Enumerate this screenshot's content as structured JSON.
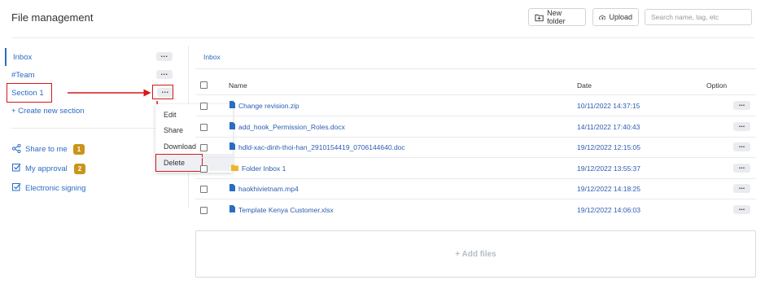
{
  "header": {
    "title": "File management",
    "new_folder_label": "New folder",
    "upload_label": "Upload",
    "search_placeholder": "Search name, tag, etc"
  },
  "sidebar": {
    "sections": [
      {
        "label": "Inbox"
      },
      {
        "label": "#Team"
      },
      {
        "label": "Section 1"
      }
    ],
    "create_section_label": "+ Create new section",
    "links": [
      {
        "label": "Share to me",
        "badge": "1"
      },
      {
        "label": "My approval",
        "badge": "2"
      },
      {
        "label": "Electronic signing"
      }
    ]
  },
  "context_menu": {
    "items": [
      "Edit",
      "Share",
      "Download",
      "Delete"
    ]
  },
  "breadcrumb": "Inbox",
  "table": {
    "headers": {
      "name": "Name",
      "date": "Date",
      "option": "Option"
    },
    "rows": [
      {
        "name": "Change revision.zip",
        "date": "10/11/2022 14:37:15",
        "type": "file"
      },
      {
        "name": "add_hook_Permission_Roles.docx",
        "date": "14/11/2022 17:40:43",
        "type": "file"
      },
      {
        "name": "hdld-xac-dinh-thoi-han_2910154419_0706144640.doc",
        "date": "19/12/2022 12:15:05",
        "type": "file"
      },
      {
        "name": "Folder Inbox 1",
        "date": "19/12/2022 13:55:37",
        "type": "folder"
      },
      {
        "name": "haokhivietnam.mp4",
        "date": "19/12/2022 14:18:25",
        "type": "file"
      },
      {
        "name": "Template Kenya Customer.xlsx",
        "date": "19/12/2022 14:06:03",
        "type": "file"
      }
    ]
  },
  "add_files_label": "+ Add files",
  "colors": {
    "link": "#2b6cc4",
    "badge": "#c9951a",
    "annotation": "#d4181b",
    "folder": "#f0b429"
  }
}
